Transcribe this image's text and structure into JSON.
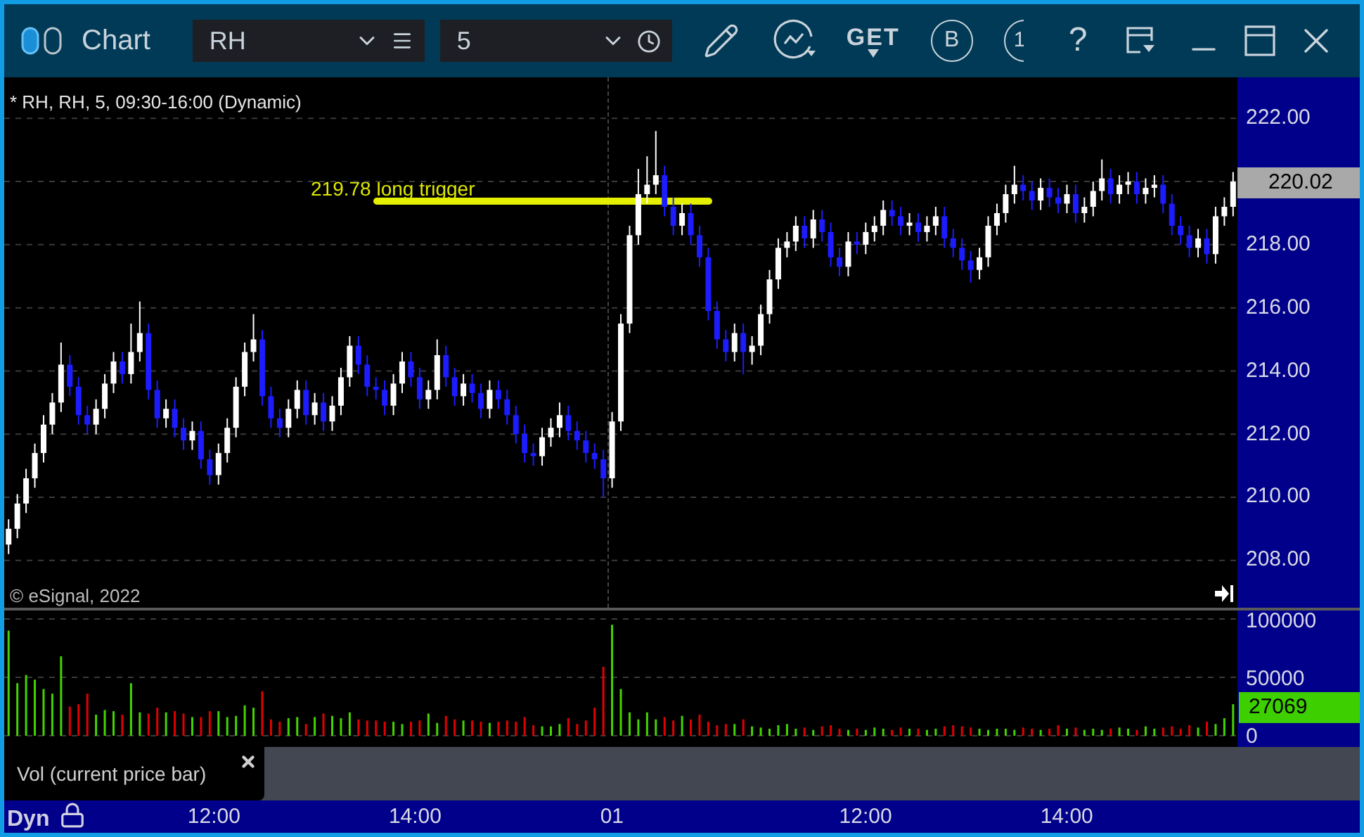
{
  "window": {
    "title": "Chart"
  },
  "toolbar": {
    "symbol": "RH",
    "interval": "5",
    "get_label": "GET",
    "b_label": "B",
    "partial_label": "1",
    "help_label": "?"
  },
  "chart": {
    "header": "* RH, RH, 5, 09:30-16:00 (Dynamic)",
    "annotation": "219.78 long trigger",
    "copyright": "© eSignal, 2022",
    "current_price": "220.02",
    "chart_data": {
      "type": "candlestick",
      "grid": true,
      "ohlc": [
        [
          208.5,
          209.3,
          208.2,
          209.0
        ],
        [
          209.0,
          210.1,
          208.7,
          209.8
        ],
        [
          209.8,
          210.9,
          209.5,
          210.6
        ],
        [
          210.6,
          211.7,
          210.3,
          211.4
        ],
        [
          211.4,
          212.6,
          211.1,
          212.3
        ],
        [
          212.3,
          213.3,
          212.0,
          213.0
        ],
        [
          213.0,
          214.9,
          212.7,
          214.2
        ],
        [
          214.2,
          214.5,
          213.2,
          213.5
        ],
        [
          213.5,
          213.8,
          212.3,
          212.6
        ],
        [
          212.6,
          212.9,
          212.0,
          212.3
        ],
        [
          212.3,
          213.1,
          212.0,
          212.8
        ],
        [
          212.8,
          213.9,
          212.5,
          213.6
        ],
        [
          213.6,
          214.6,
          213.3,
          214.3
        ],
        [
          214.3,
          214.6,
          213.6,
          213.9
        ],
        [
          213.9,
          215.5,
          213.6,
          214.6
        ],
        [
          214.6,
          216.2,
          214.3,
          215.2
        ],
        [
          215.2,
          215.5,
          213.1,
          213.4
        ],
        [
          213.4,
          213.7,
          212.2,
          212.5
        ],
        [
          212.5,
          213.1,
          212.2,
          212.8
        ],
        [
          212.8,
          213.1,
          211.9,
          212.2
        ],
        [
          212.2,
          212.5,
          211.5,
          211.8
        ],
        [
          211.8,
          212.4,
          211.5,
          212.1
        ],
        [
          212.1,
          212.4,
          210.9,
          211.2
        ],
        [
          211.2,
          211.5,
          210.4,
          210.7
        ],
        [
          210.7,
          211.7,
          210.4,
          211.4
        ],
        [
          211.4,
          212.5,
          211.1,
          212.2
        ],
        [
          212.2,
          213.8,
          211.9,
          213.5
        ],
        [
          213.5,
          214.9,
          213.2,
          214.6
        ],
        [
          214.6,
          215.8,
          214.3,
          215.0
        ],
        [
          215.0,
          215.3,
          212.9,
          213.2
        ],
        [
          213.2,
          213.5,
          212.2,
          212.5
        ],
        [
          212.5,
          212.8,
          211.9,
          212.2
        ],
        [
          212.2,
          213.1,
          211.9,
          212.8
        ],
        [
          212.8,
          213.7,
          212.5,
          213.4
        ],
        [
          213.4,
          213.7,
          212.3,
          212.6
        ],
        [
          212.6,
          213.3,
          212.3,
          213.0
        ],
        [
          213.0,
          213.3,
          212.1,
          212.4
        ],
        [
          212.4,
          213.2,
          212.1,
          212.9
        ],
        [
          212.9,
          214.1,
          212.6,
          213.8
        ],
        [
          213.8,
          215.1,
          213.5,
          214.8
        ],
        [
          214.8,
          215.1,
          213.9,
          214.2
        ],
        [
          214.2,
          214.5,
          213.2,
          213.5
        ],
        [
          213.5,
          213.8,
          213.1,
          213.4
        ],
        [
          213.4,
          213.7,
          212.6,
          212.9
        ],
        [
          212.9,
          213.9,
          212.6,
          213.6
        ],
        [
          213.6,
          214.6,
          213.3,
          214.3
        ],
        [
          214.3,
          214.6,
          213.5,
          213.8
        ],
        [
          213.8,
          214.1,
          212.8,
          213.1
        ],
        [
          213.1,
          213.7,
          212.8,
          213.4
        ],
        [
          213.4,
          215.0,
          213.1,
          214.5
        ],
        [
          214.5,
          214.8,
          213.5,
          213.8
        ],
        [
          213.8,
          214.1,
          212.9,
          213.2
        ],
        [
          213.2,
          213.9,
          212.9,
          213.6
        ],
        [
          213.6,
          213.9,
          213.0,
          213.3
        ],
        [
          213.3,
          213.6,
          212.5,
          212.8
        ],
        [
          212.8,
          213.7,
          212.5,
          213.4
        ],
        [
          213.4,
          213.7,
          212.8,
          213.1
        ],
        [
          213.1,
          213.4,
          212.3,
          212.6
        ],
        [
          212.6,
          212.9,
          211.7,
          212.0
        ],
        [
          212.0,
          212.3,
          211.1,
          211.4
        ],
        [
          211.4,
          211.7,
          211.0,
          211.3
        ],
        [
          211.3,
          212.2,
          211.0,
          211.9
        ],
        [
          211.9,
          212.5,
          211.6,
          212.2
        ],
        [
          212.2,
          213.0,
          211.9,
          212.6
        ],
        [
          212.6,
          212.9,
          211.8,
          212.1
        ],
        [
          212.1,
          212.4,
          211.5,
          211.8
        ],
        [
          211.8,
          212.1,
          211.1,
          211.4
        ],
        [
          211.4,
          211.7,
          210.9,
          211.2
        ],
        [
          211.2,
          211.5,
          210.0,
          210.6
        ],
        [
          210.6,
          212.7,
          210.3,
          212.4
        ],
        [
          212.4,
          215.8,
          212.1,
          215.5
        ],
        [
          215.5,
          218.6,
          215.2,
          218.3
        ],
        [
          218.3,
          220.4,
          218.0,
          219.6
        ],
        [
          219.6,
          220.8,
          219.3,
          219.9
        ],
        [
          219.9,
          221.6,
          219.6,
          220.2
        ],
        [
          220.2,
          220.5,
          218.9,
          219.2
        ],
        [
          219.2,
          219.5,
          218.3,
          218.6
        ],
        [
          218.6,
          219.3,
          218.3,
          219.0
        ],
        [
          219.0,
          219.3,
          218.0,
          218.3
        ],
        [
          218.3,
          218.6,
          217.3,
          217.6
        ],
        [
          217.6,
          217.9,
          215.6,
          215.9
        ],
        [
          215.9,
          216.2,
          214.7,
          215.0
        ],
        [
          215.0,
          215.3,
          214.3,
          214.6
        ],
        [
          214.6,
          215.5,
          214.3,
          215.2
        ],
        [
          215.2,
          215.5,
          213.9,
          214.6
        ],
        [
          214.6,
          215.1,
          214.2,
          214.8
        ],
        [
          214.8,
          216.1,
          214.5,
          215.8
        ],
        [
          215.8,
          217.2,
          215.5,
          216.9
        ],
        [
          216.9,
          218.2,
          216.6,
          217.9
        ],
        [
          217.9,
          218.4,
          217.6,
          218.1
        ],
        [
          218.1,
          218.9,
          217.8,
          218.6
        ],
        [
          218.6,
          218.9,
          217.9,
          218.2
        ],
        [
          218.2,
          219.1,
          217.9,
          218.8
        ],
        [
          218.8,
          219.1,
          218.1,
          218.4
        ],
        [
          218.4,
          218.7,
          217.3,
          217.6
        ],
        [
          217.6,
          217.9,
          217.0,
          217.3
        ],
        [
          217.3,
          218.4,
          217.0,
          218.1
        ],
        [
          218.1,
          218.4,
          217.7,
          218.0
        ],
        [
          218.0,
          218.7,
          217.7,
          218.4
        ],
        [
          218.4,
          218.9,
          218.1,
          218.6
        ],
        [
          218.6,
          219.4,
          218.3,
          219.1
        ],
        [
          219.1,
          219.4,
          218.6,
          218.9
        ],
        [
          218.9,
          219.2,
          218.3,
          218.6
        ],
        [
          218.6,
          219.0,
          218.3,
          218.7
        ],
        [
          218.7,
          219.0,
          218.1,
          218.4
        ],
        [
          218.4,
          218.9,
          218.1,
          218.6
        ],
        [
          218.6,
          219.2,
          218.3,
          218.9
        ],
        [
          218.9,
          219.2,
          217.9,
          218.2
        ],
        [
          218.2,
          218.5,
          217.6,
          217.9
        ],
        [
          217.9,
          218.2,
          217.2,
          217.5
        ],
        [
          217.5,
          217.8,
          216.8,
          217.2
        ],
        [
          217.2,
          217.9,
          216.9,
          217.6
        ],
        [
          217.6,
          218.9,
          217.3,
          218.6
        ],
        [
          218.6,
          219.3,
          218.3,
          219.0
        ],
        [
          219.0,
          219.9,
          218.7,
          219.6
        ],
        [
          219.6,
          220.5,
          219.3,
          219.9
        ],
        [
          219.9,
          220.2,
          219.4,
          219.7
        ],
        [
          219.7,
          220.0,
          219.1,
          219.4
        ],
        [
          219.4,
          220.1,
          219.1,
          219.8
        ],
        [
          219.8,
          220.1,
          219.2,
          219.5
        ],
        [
          219.5,
          219.8,
          219.0,
          219.3
        ],
        [
          219.3,
          219.9,
          219.0,
          219.6
        ],
        [
          219.6,
          219.9,
          218.7,
          219.0
        ],
        [
          219.0,
          219.5,
          218.7,
          219.2
        ],
        [
          219.2,
          220.0,
          218.9,
          219.7
        ],
        [
          219.7,
          220.7,
          219.4,
          220.1
        ],
        [
          220.1,
          220.4,
          219.3,
          219.6
        ],
        [
          219.6,
          220.2,
          219.3,
          219.9
        ],
        [
          219.9,
          220.3,
          219.6,
          220.0
        ],
        [
          220.0,
          220.3,
          219.3,
          219.6
        ],
        [
          219.6,
          220.1,
          219.3,
          219.8
        ],
        [
          219.8,
          220.2,
          219.5,
          219.9
        ],
        [
          219.9,
          220.2,
          219.0,
          219.3
        ],
        [
          219.3,
          219.6,
          218.3,
          218.6
        ],
        [
          218.6,
          218.9,
          218.0,
          218.3
        ],
        [
          218.3,
          218.6,
          217.6,
          217.9
        ],
        [
          217.9,
          218.5,
          217.6,
          218.2
        ],
        [
          218.2,
          218.5,
          217.4,
          217.7
        ],
        [
          217.7,
          219.2,
          217.4,
          218.9
        ],
        [
          218.9,
          219.5,
          218.6,
          219.2
        ],
        [
          219.2,
          220.3,
          218.9,
          220.0
        ]
      ],
      "ylim": [
        206.5,
        223.3
      ],
      "yticks": [
        {
          "value": 222,
          "label": "222.00"
        },
        {
          "value": 218,
          "label": "218.00"
        },
        {
          "value": 216,
          "label": "216.00"
        },
        {
          "value": 214,
          "label": "214.00"
        },
        {
          "value": 212,
          "label": "212.00"
        },
        {
          "value": 210,
          "label": "210.00"
        },
        {
          "value": 208,
          "label": "208.00"
        }
      ]
    }
  },
  "volume": {
    "current": "27069",
    "legend": "Vol (current price bar)",
    "chart_data": {
      "type": "bar",
      "values": [
        90000,
        45000,
        52000,
        48000,
        40000,
        36000,
        68000,
        25000,
        27000,
        36000,
        18000,
        22000,
        21000,
        18000,
        45000,
        20000,
        19000,
        24000,
        20000,
        21000,
        19000,
        16000,
        16000,
        21000,
        21000,
        16000,
        17000,
        26000,
        24000,
        38000,
        14000,
        12000,
        15000,
        16000,
        10000,
        16000,
        19000,
        17000,
        15000,
        20000,
        14000,
        13000,
        13000,
        12000,
        12000,
        10000,
        12000,
        13000,
        19000,
        11000,
        17000,
        14000,
        13000,
        13000,
        12000,
        11000,
        12000,
        13000,
        12000,
        16000,
        9000,
        8000,
        8000,
        10000,
        15000,
        10000,
        13000,
        24000,
        59000,
        95000,
        40000,
        20000,
        14000,
        20000,
        14000,
        16000,
        13000,
        17000,
        14000,
        18000,
        12000,
        9000,
        10000,
        10000,
        14000,
        8000,
        7000,
        6000,
        9000,
        10000,
        6000,
        7000,
        5000,
        8000,
        9000,
        6000,
        5000,
        6000,
        5000,
        7000,
        6000,
        5000,
        7000,
        6000,
        6000,
        5000,
        6000,
        8000,
        9000,
        8000,
        7000,
        6000,
        5000,
        6000,
        6000,
        5000,
        7000,
        6000,
        5000,
        6000,
        9000,
        6000,
        7000,
        5000,
        6000,
        5000,
        6000,
        7000,
        6000,
        5000,
        8000,
        6000,
        7000,
        8000,
        6000,
        9000,
        7000,
        12000,
        10000,
        15000,
        27000
      ],
      "ylim": [
        0,
        107200
      ],
      "yticks": [
        {
          "value": 100000,
          "label": "100000"
        },
        {
          "value": 50000,
          "label": "50000"
        },
        {
          "value": 0,
          "label": "0"
        }
      ]
    }
  },
  "time_axis": {
    "mode": "Dyn",
    "locked": true,
    "labels": [
      "12:00",
      "14:00",
      "01",
      "12:00",
      "14:00"
    ]
  }
}
